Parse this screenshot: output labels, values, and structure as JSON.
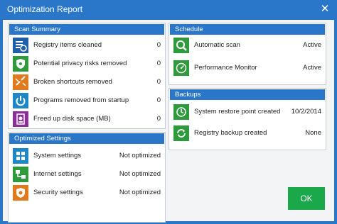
{
  "window": {
    "title": "Optimization Report",
    "close_glyph": "✕"
  },
  "scan_summary": {
    "header": "Scan Summary",
    "items": [
      {
        "icon": "registry-icon",
        "label": "Registry items cleaned",
        "value": "0",
        "color": "#1e5fa8"
      },
      {
        "icon": "privacy-shield-icon",
        "label": "Potential privacy risks removed",
        "value": "0",
        "color": "#2f9a3c"
      },
      {
        "icon": "broken-shortcut-icon",
        "label": "Broken shortcuts removed",
        "value": "0",
        "color": "#e07a1c"
      },
      {
        "icon": "power-icon",
        "label": "Programs removed from startup",
        "value": "0",
        "color": "#1f86c7"
      },
      {
        "icon": "disk-icon",
        "label": "Freed up disk space (MB)",
        "value": "0",
        "color": "#8a2f95"
      }
    ]
  },
  "optimized_settings": {
    "header": "Optimized Settings",
    "items": [
      {
        "icon": "windows-icon",
        "label": "System settings",
        "value": "Not optimized",
        "color": "#1f86c7"
      },
      {
        "icon": "network-icon",
        "label": "Internet settings",
        "value": "Not optimized",
        "color": "#2f9a3c"
      },
      {
        "icon": "security-gear-icon",
        "label": "Security settings",
        "value": "Not optimized",
        "color": "#e07a1c"
      }
    ]
  },
  "schedule": {
    "header": "Schedule",
    "items": [
      {
        "icon": "scan-icon",
        "label": "Automatic scan",
        "value": "Active",
        "color": "#2f9a3c"
      },
      {
        "icon": "monitor-gauge-icon",
        "label": "Performance Monitor",
        "value": "Active",
        "color": "#2f9a3c"
      }
    ]
  },
  "backups": {
    "header": "Backups",
    "items": [
      {
        "icon": "restore-point-icon",
        "label": "System restore point created",
        "value": "10/2/2014",
        "color": "#2f9a3c"
      },
      {
        "icon": "registry-backup-icon",
        "label": "Registry backup created",
        "value": "None",
        "color": "#2f9a3c"
      }
    ]
  },
  "ok_label": "OK"
}
